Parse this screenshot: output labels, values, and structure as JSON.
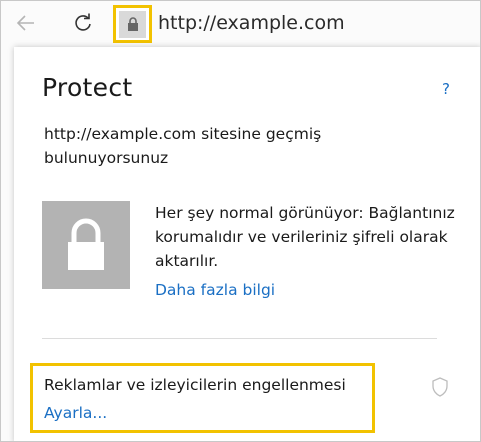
{
  "address_bar": {
    "url": "http://example.com"
  },
  "icons": {
    "back": "back-arrow-icon",
    "refresh": "refresh-icon",
    "lock": "lock-icon",
    "shield": "shield-icon"
  },
  "panel": {
    "title": "Protect",
    "help": "?",
    "site_message": "http://example.com  sitesine geçmiş bulunuyorsunuz",
    "status": "Her şey normal görünüyor: Bağlantınız korumalıdır ve verileriniz şifreli olarak aktarılır.",
    "more_info": "Daha fazla bilgi",
    "tracking": {
      "label": "Reklamlar ve izleyicilerin engellenmesi",
      "settings": "Ayarla..."
    }
  },
  "colors": {
    "highlight": "#f2c200",
    "link": "#1a6fc4",
    "lock_bg": "#b3b3b3"
  }
}
